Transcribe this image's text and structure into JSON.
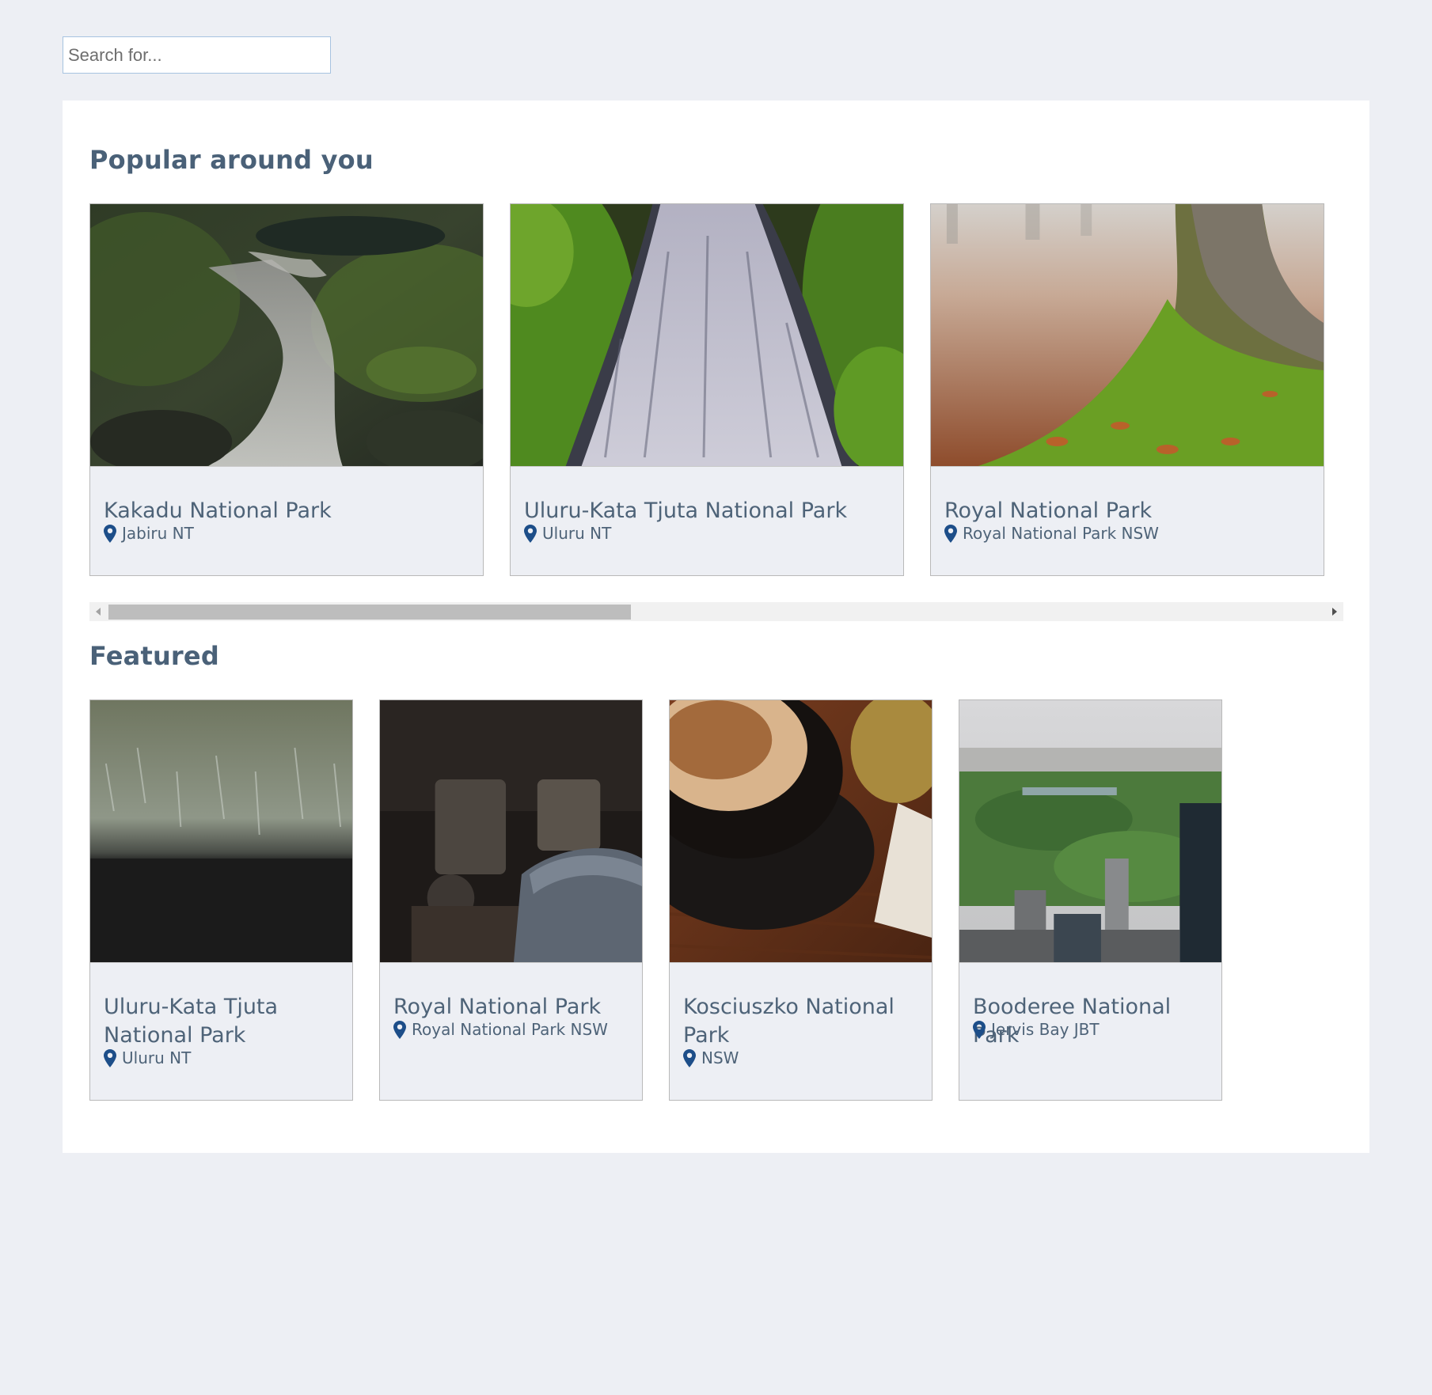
{
  "search": {
    "placeholder": "Search for..."
  },
  "popular": {
    "title": "Popular around you",
    "cards": [
      {
        "name": "Kakadu National Park",
        "location": "Jabiru NT",
        "image": "waterfall-stream-photo"
      },
      {
        "name": "Uluru-Kata Tjuta National Park",
        "location": "Uluru NT",
        "image": "cascading-waterfall-photo"
      },
      {
        "name": "Royal National Park",
        "location": "Royal National Park NSW",
        "image": "mossy-tree-photo"
      }
    ]
  },
  "featured": {
    "title": "Featured",
    "cards": [
      {
        "name": "Uluru-Kata Tjuta National Park",
        "location": "Uluru NT",
        "image": "frosty-grass-photo"
      },
      {
        "name": "Royal National Park",
        "location": "Royal National Park NSW",
        "image": "old-machinery-photo"
      },
      {
        "name": "Kosciuszko National Park",
        "location": "NSW",
        "image": "coffee-cup-photo"
      },
      {
        "name": "Booderee National Park",
        "location": "Jervis Bay JBT",
        "image": "city-park-aerial-photo"
      }
    ]
  },
  "colors": {
    "page_background": "#edeff4",
    "heading": "#4a6178",
    "pin": "#1d4e89"
  }
}
